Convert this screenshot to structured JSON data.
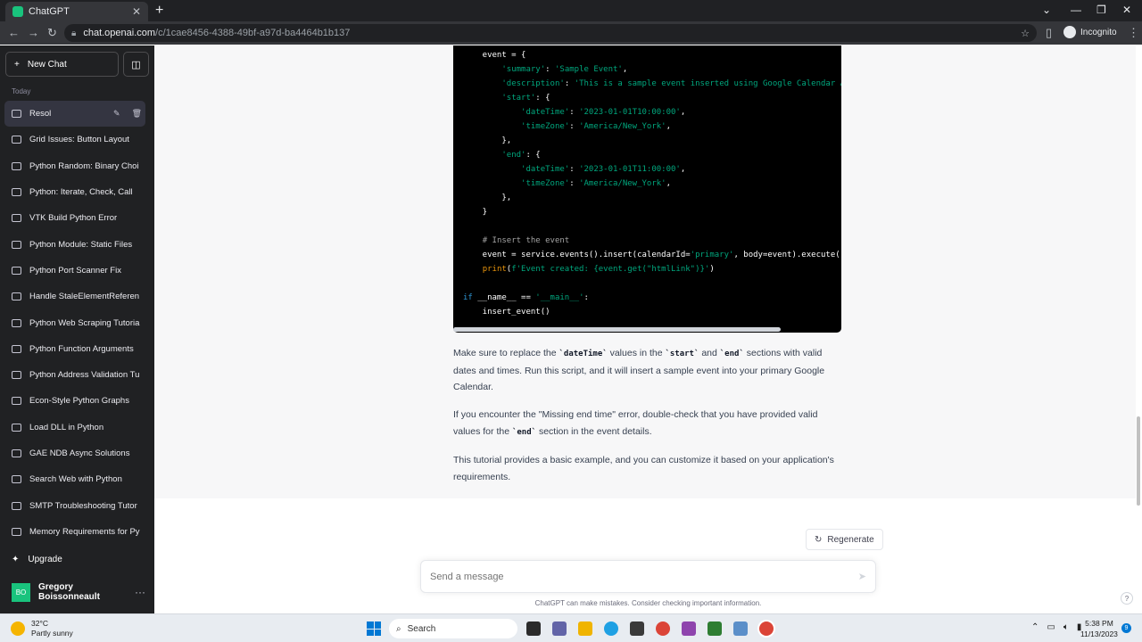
{
  "browser": {
    "tab_title": "ChatGPT",
    "url_host": "chat.openai.com",
    "url_path": "/c/1cae8456-4388-49bf-a97d-ba4464b1b137",
    "incognito_label": "Incognito"
  },
  "sidebar": {
    "new_chat": "New Chat",
    "section": "Today",
    "items": [
      {
        "label": "Resol"
      },
      {
        "label": "Grid Issues: Button Layout"
      },
      {
        "label": "Python Random: Binary Choi"
      },
      {
        "label": "Python: Iterate, Check, Call"
      },
      {
        "label": "VTK Build Python Error"
      },
      {
        "label": "Python Module: Static Files"
      },
      {
        "label": "Python Port Scanner Fix"
      },
      {
        "label": "Handle StaleElementReferen"
      },
      {
        "label": "Python Web Scraping Tutoria"
      },
      {
        "label": "Python Function Arguments"
      },
      {
        "label": "Python Address Validation Tu"
      },
      {
        "label": "Econ-Style Python Graphs"
      },
      {
        "label": "Load DLL in Python"
      },
      {
        "label": "GAE NDB Async Solutions"
      },
      {
        "label": "Search Web with Python"
      },
      {
        "label": "SMTP Troubleshooting Tutor"
      },
      {
        "label": "Memory Requirements for Py"
      }
    ],
    "upgrade": "Upgrade",
    "user_initials": "BO",
    "user_name": "Gregory Boissonneault"
  },
  "chat": {
    "code_lines": [
      "    event = {",
      "        'summary': 'Sample Event',",
      "        'description': 'This is a sample event inserted using Google Calendar API.',",
      "        'start': {",
      "            'dateTime': '2023-01-01T10:00:00',",
      "            'timeZone': 'America/New_York',",
      "        },",
      "        'end': {",
      "            'dateTime': '2023-01-01T11:00:00',",
      "            'timeZone': 'America/New_York',",
      "        },",
      "    }",
      "",
      "    # Insert the event",
      "    event = service.events().insert(calendarId='primary', body=event).execute()",
      "    print(f'Event created: {event.get(\"htmlLink\")}')",
      "",
      "if __name__ == '__main__':",
      "    insert_event()"
    ],
    "para1_a": "Make sure to replace the ",
    "para1_code1": "`dateTime`",
    "para1_b": " values in the ",
    "para1_code2": "`start`",
    "para1_c": " and ",
    "para1_code3": "`end`",
    "para1_d": " sections with valid dates and times. Run this script, and it will insert a sample event into your primary Google Calendar.",
    "para2_a": "If you encounter the \"Missing end time\" error, double-check that you have provided valid values for the ",
    "para2_code": "`end`",
    "para2_b": " section in the event details.",
    "para3": "This tutorial provides a basic example, and you can customize it based on your application's requirements.",
    "regenerate": "Regenerate",
    "input_placeholder": "Send a message",
    "disclaimer": "ChatGPT can make mistakes. Consider checking important information.",
    "help": "?"
  },
  "taskbar": {
    "temp": "32°C",
    "weather": "Partly sunny",
    "search": "Search",
    "time": "5:38 PM",
    "date": "11/13/2023",
    "notifications": "9"
  }
}
